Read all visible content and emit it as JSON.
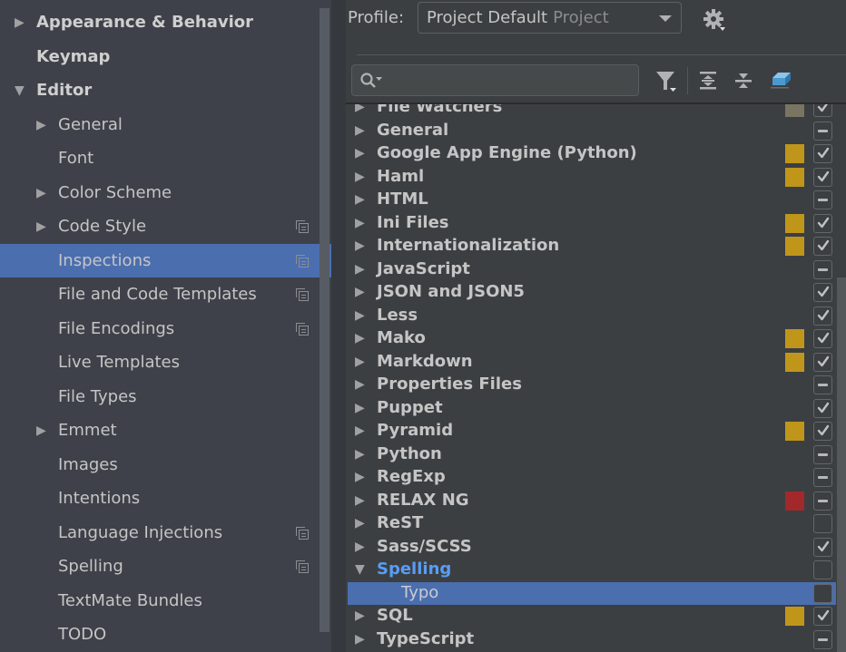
{
  "sidebar": {
    "items": [
      {
        "label": "Appearance & Behavior",
        "level": 0,
        "arrow": "right",
        "bold": true,
        "project_icon": false,
        "selected": false
      },
      {
        "label": "Keymap",
        "level": 0,
        "arrow": "none",
        "bold": true,
        "project_icon": false,
        "selected": false
      },
      {
        "label": "Editor",
        "level": 0,
        "arrow": "down",
        "bold": true,
        "project_icon": false,
        "selected": false
      },
      {
        "label": "General",
        "level": 1,
        "arrow": "right",
        "bold": false,
        "project_icon": false,
        "selected": false
      },
      {
        "label": "Font",
        "level": 1,
        "arrow": "none",
        "bold": false,
        "project_icon": false,
        "selected": false
      },
      {
        "label": "Color Scheme",
        "level": 1,
        "arrow": "right",
        "bold": false,
        "project_icon": false,
        "selected": false
      },
      {
        "label": "Code Style",
        "level": 1,
        "arrow": "right",
        "bold": false,
        "project_icon": true,
        "selected": false
      },
      {
        "label": "Inspections",
        "level": 1,
        "arrow": "none",
        "bold": false,
        "project_icon": true,
        "selected": true
      },
      {
        "label": "File and Code Templates",
        "level": 1,
        "arrow": "none",
        "bold": false,
        "project_icon": true,
        "selected": false
      },
      {
        "label": "File Encodings",
        "level": 1,
        "arrow": "none",
        "bold": false,
        "project_icon": true,
        "selected": false
      },
      {
        "label": "Live Templates",
        "level": 1,
        "arrow": "none",
        "bold": false,
        "project_icon": false,
        "selected": false
      },
      {
        "label": "File Types",
        "level": 1,
        "arrow": "none",
        "bold": false,
        "project_icon": false,
        "selected": false
      },
      {
        "label": "Emmet",
        "level": 1,
        "arrow": "right",
        "bold": false,
        "project_icon": false,
        "selected": false
      },
      {
        "label": "Images",
        "level": 1,
        "arrow": "none",
        "bold": false,
        "project_icon": false,
        "selected": false
      },
      {
        "label": "Intentions",
        "level": 1,
        "arrow": "none",
        "bold": false,
        "project_icon": false,
        "selected": false
      },
      {
        "label": "Language Injections",
        "level": 1,
        "arrow": "none",
        "bold": false,
        "project_icon": true,
        "selected": false
      },
      {
        "label": "Spelling",
        "level": 1,
        "arrow": "none",
        "bold": false,
        "project_icon": true,
        "selected": false
      },
      {
        "label": "TextMate Bundles",
        "level": 1,
        "arrow": "none",
        "bold": false,
        "project_icon": false,
        "selected": false
      },
      {
        "label": "TODO",
        "level": 1,
        "arrow": "none",
        "bold": false,
        "project_icon": false,
        "selected": false
      }
    ]
  },
  "profile": {
    "label": "Profile:",
    "value": "Project Default",
    "scope": "Project"
  },
  "toolbar": {
    "search_placeholder": "",
    "icons": [
      "filter-icon",
      "expand-all-icon",
      "collapse-all-icon",
      "reset-eraser-icon"
    ]
  },
  "colors": {
    "accent_selected": "#4b6eaf",
    "severity_warning": "#c0961a",
    "severity_error": "#a3282a",
    "severity_weak": "#7a7462",
    "highlight_text": "#589df6"
  },
  "inspections": {
    "rows": [
      {
        "label": "File Watchers",
        "expanded": false,
        "severity": "weak",
        "state": "checked",
        "child": false,
        "selected": false,
        "highlight": false
      },
      {
        "label": "General",
        "expanded": false,
        "severity": "none",
        "state": "mixed",
        "child": false,
        "selected": false,
        "highlight": false
      },
      {
        "label": "Google App Engine (Python)",
        "expanded": false,
        "severity": "warning",
        "state": "checked",
        "child": false,
        "selected": false,
        "highlight": false
      },
      {
        "label": "Haml",
        "expanded": false,
        "severity": "warning",
        "state": "checked",
        "child": false,
        "selected": false,
        "highlight": false
      },
      {
        "label": "HTML",
        "expanded": false,
        "severity": "none",
        "state": "mixed",
        "child": false,
        "selected": false,
        "highlight": false
      },
      {
        "label": "Ini Files",
        "expanded": false,
        "severity": "warning",
        "state": "checked",
        "child": false,
        "selected": false,
        "highlight": false
      },
      {
        "label": "Internationalization",
        "expanded": false,
        "severity": "warning",
        "state": "checked",
        "child": false,
        "selected": false,
        "highlight": false
      },
      {
        "label": "JavaScript",
        "expanded": false,
        "severity": "none",
        "state": "mixed",
        "child": false,
        "selected": false,
        "highlight": false
      },
      {
        "label": "JSON and JSON5",
        "expanded": false,
        "severity": "none",
        "state": "checked",
        "child": false,
        "selected": false,
        "highlight": false
      },
      {
        "label": "Less",
        "expanded": false,
        "severity": "none",
        "state": "checked",
        "child": false,
        "selected": false,
        "highlight": false
      },
      {
        "label": "Mako",
        "expanded": false,
        "severity": "warning",
        "state": "checked",
        "child": false,
        "selected": false,
        "highlight": false
      },
      {
        "label": "Markdown",
        "expanded": false,
        "severity": "warning",
        "state": "checked",
        "child": false,
        "selected": false,
        "highlight": false
      },
      {
        "label": "Properties Files",
        "expanded": false,
        "severity": "none",
        "state": "mixed",
        "child": false,
        "selected": false,
        "highlight": false
      },
      {
        "label": "Puppet",
        "expanded": false,
        "severity": "none",
        "state": "checked",
        "child": false,
        "selected": false,
        "highlight": false
      },
      {
        "label": "Pyramid",
        "expanded": false,
        "severity": "warning",
        "state": "checked",
        "child": false,
        "selected": false,
        "highlight": false
      },
      {
        "label": "Python",
        "expanded": false,
        "severity": "none",
        "state": "mixed",
        "child": false,
        "selected": false,
        "highlight": false
      },
      {
        "label": "RegExp",
        "expanded": false,
        "severity": "none",
        "state": "mixed",
        "child": false,
        "selected": false,
        "highlight": false
      },
      {
        "label": "RELAX NG",
        "expanded": false,
        "severity": "error",
        "state": "mixed",
        "child": false,
        "selected": false,
        "highlight": false
      },
      {
        "label": "ReST",
        "expanded": false,
        "severity": "none",
        "state": "unchecked",
        "child": false,
        "selected": false,
        "highlight": false
      },
      {
        "label": "Sass/SCSS",
        "expanded": false,
        "severity": "none",
        "state": "checked",
        "child": false,
        "selected": false,
        "highlight": false
      },
      {
        "label": "Spelling",
        "expanded": true,
        "severity": "none",
        "state": "unchecked",
        "child": false,
        "selected": false,
        "highlight": true
      },
      {
        "label": "Typo",
        "expanded": false,
        "severity": "none",
        "state": "unchecked",
        "child": true,
        "selected": true,
        "highlight": false
      },
      {
        "label": "SQL",
        "expanded": false,
        "severity": "warning",
        "state": "checked",
        "child": false,
        "selected": false,
        "highlight": false
      },
      {
        "label": "TypeScript",
        "expanded": false,
        "severity": "none",
        "state": "mixed",
        "child": false,
        "selected": false,
        "highlight": false
      }
    ]
  }
}
